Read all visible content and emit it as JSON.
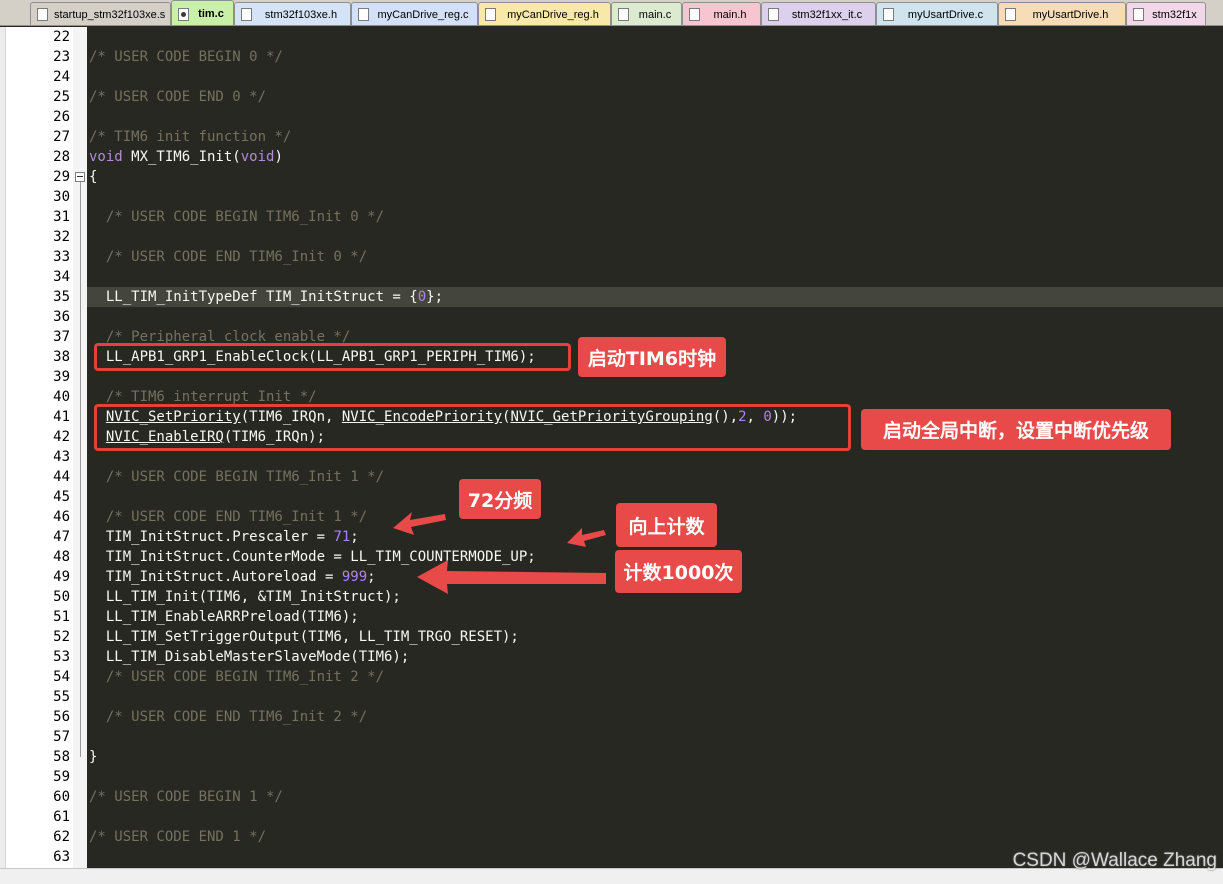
{
  "tabs": [
    {
      "label": "startup_stm32f103xe.s",
      "color": "#d4d0c8",
      "active": false
    },
    {
      "label": "tim.c",
      "color": "#c8f0a8",
      "active": true
    },
    {
      "label": "stm32f103xe.h",
      "color": "#d4e3f5",
      "active": false
    },
    {
      "label": "myCanDrive_reg.c",
      "color": "#d2e1f7",
      "active": false
    },
    {
      "label": "myCanDrive_reg.h",
      "color": "#f9e9a8",
      "active": false
    },
    {
      "label": "main.c",
      "color": "#dcebd0",
      "active": false
    },
    {
      "label": "main.h",
      "color": "#f6c5cf",
      "active": false
    },
    {
      "label": "stm32f1xx_it.c",
      "color": "#dcd0ec",
      "active": false
    },
    {
      "label": "myUsartDrive.c",
      "color": "#cfe4ee",
      "active": false
    },
    {
      "label": "myUsartDrive.h",
      "color": "#f7dcb8",
      "active": false
    },
    {
      "label": "stm32f1x",
      "color": "#f2d7e8",
      "active": false
    }
  ],
  "editor": {
    "current_line": 35,
    "lines": [
      {
        "n": "22",
        "code": ""
      },
      {
        "n": "23",
        "code": "/* USER CODE BEGIN 0 */"
      },
      {
        "n": "24",
        "code": ""
      },
      {
        "n": "25",
        "code": "/* USER CODE END 0 */"
      },
      {
        "n": "26",
        "code": ""
      },
      {
        "n": "27",
        "code": "/* TIM6 init function */"
      },
      {
        "n": "28",
        "code": "void MX_TIM6_Init(void)"
      },
      {
        "n": "29",
        "code": "{"
      },
      {
        "n": "30",
        "code": ""
      },
      {
        "n": "31",
        "code": "  /* USER CODE BEGIN TIM6_Init 0 */"
      },
      {
        "n": "32",
        "code": ""
      },
      {
        "n": "33",
        "code": "  /* USER CODE END TIM6_Init 0 */"
      },
      {
        "n": "34",
        "code": ""
      },
      {
        "n": "35",
        "code": "  LL_TIM_InitTypeDef TIM_InitStruct = {0};"
      },
      {
        "n": "36",
        "code": ""
      },
      {
        "n": "37",
        "code": "  /* Peripheral clock enable */"
      },
      {
        "n": "38",
        "code": "  LL_APB1_GRP1_EnableClock(LL_APB1_GRP1_PERIPH_TIM6);"
      },
      {
        "n": "39",
        "code": ""
      },
      {
        "n": "40",
        "code": "  /* TIM6 interrupt Init */"
      },
      {
        "n": "41",
        "code": "  NVIC_SetPriority(TIM6_IRQn, NVIC_EncodePriority(NVIC_GetPriorityGrouping(),2, 0));"
      },
      {
        "n": "42",
        "code": "  NVIC_EnableIRQ(TIM6_IRQn);"
      },
      {
        "n": "43",
        "code": ""
      },
      {
        "n": "44",
        "code": "  /* USER CODE BEGIN TIM6_Init 1 */"
      },
      {
        "n": "45",
        "code": ""
      },
      {
        "n": "46",
        "code": "  /* USER CODE END TIM6_Init 1 */"
      },
      {
        "n": "47",
        "code": "  TIM_InitStruct.Prescaler = 71;"
      },
      {
        "n": "48",
        "code": "  TIM_InitStruct.CounterMode = LL_TIM_COUNTERMODE_UP;"
      },
      {
        "n": "49",
        "code": "  TIM_InitStruct.Autoreload = 999;"
      },
      {
        "n": "50",
        "code": "  LL_TIM_Init(TIM6, &TIM_InitStruct);"
      },
      {
        "n": "51",
        "code": "  LL_TIM_EnableARRPreload(TIM6);"
      },
      {
        "n": "52",
        "code": "  LL_TIM_SetTriggerOutput(TIM6, LL_TIM_TRGO_RESET);"
      },
      {
        "n": "53",
        "code": "  LL_TIM_DisableMasterSlaveMode(TIM6);"
      },
      {
        "n": "54",
        "code": "  /* USER CODE BEGIN TIM6_Init 2 */"
      },
      {
        "n": "55",
        "code": ""
      },
      {
        "n": "56",
        "code": "  /* USER CODE END TIM6_Init 2 */"
      },
      {
        "n": "57",
        "code": ""
      },
      {
        "n": "58",
        "code": "}"
      },
      {
        "n": "59",
        "code": ""
      },
      {
        "n": "60",
        "code": "/* USER CODE BEGIN 1 */"
      },
      {
        "n": "61",
        "code": ""
      },
      {
        "n": "62",
        "code": "/* USER CODE END 1 */"
      },
      {
        "n": "63",
        "code": ""
      }
    ]
  },
  "annotations": {
    "clock": "启动TIM6时钟",
    "nvic": "启动全局中断，设置中断优先级",
    "prescaler": "72分频",
    "countup": "向上计数",
    "autoreload": "计数1000次"
  },
  "watermark": "CSDN @Wallace Zhang",
  "colors": {
    "editor_bg": "#272822",
    "current_line": "#44463d",
    "comment": "#75715e",
    "keyword": "#b38cd6",
    "number": "#ae81ff",
    "annotation_red": "#e84949"
  }
}
